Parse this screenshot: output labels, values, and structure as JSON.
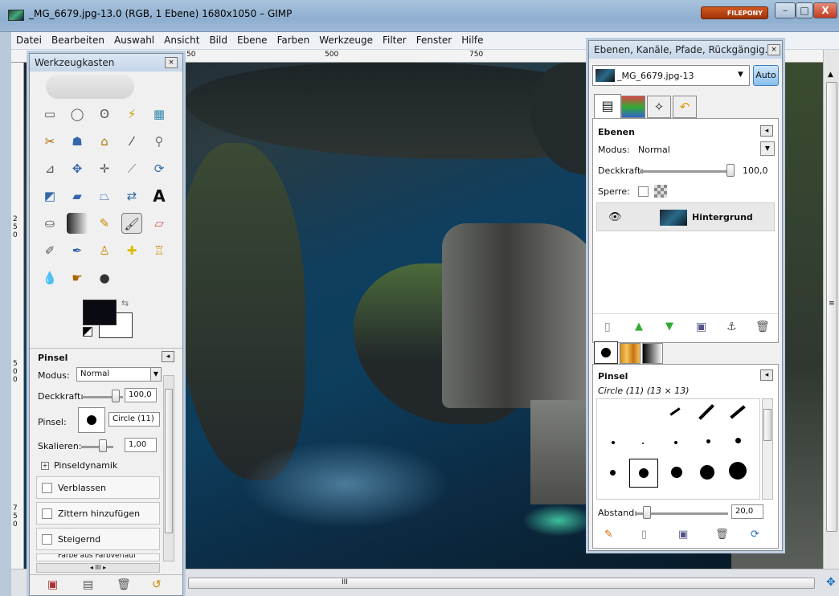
{
  "window": {
    "title": "_MG_6679.jpg-13.0 (RGB, 1 Ebene) 1680x1050 – GIMP",
    "badge": "FILEPONY",
    "minimize": "–",
    "maximize": "□",
    "close": "X"
  },
  "menu": [
    "Datei",
    "Bearbeiten",
    "Auswahl",
    "Ansicht",
    "Bild",
    "Ebene",
    "Farben",
    "Werkzeuge",
    "Filter",
    "Fenster",
    "Hilfe"
  ],
  "ruler": {
    "top": [
      "50",
      "500",
      "750"
    ],
    "left": [
      "250",
      "500",
      "750"
    ]
  },
  "toolbox": {
    "title": "Werkzeugkasten",
    "options_title": "Pinsel",
    "modus_label": "Modus:",
    "modus_value": "Normal",
    "deckkraft_label": "Deckkraft:",
    "deckkraft_value": "100,0",
    "pinsel_label": "Pinsel:",
    "pinsel_value": "Circle (11)",
    "skalieren_label": "Skalieren:",
    "skalieren_value": "1,00",
    "dynamik": "Pinseldynamik",
    "checks": [
      "Verblassen",
      "Zittern hinzufügen",
      "Steigernd",
      "Farbe aus Farbverlauf"
    ]
  },
  "layers": {
    "title": "Ebenen, Kanäle, Pfade, Rückgängig...",
    "image": "_MG_6679.jpg-13",
    "auto": "Auto",
    "section": "Ebenen",
    "modus_label": "Modus:",
    "modus_value": "Normal",
    "deckkraft_label": "Deckkraft:",
    "deckkraft_value": "100,0",
    "sperre_label": "Sperre:",
    "layer_name": "Hintergrund"
  },
  "brushes": {
    "section": "Pinsel",
    "current": "Circle (11) (13 × 13)",
    "abstand_label": "Abstand:",
    "abstand_value": "20,0"
  },
  "scroll": {
    "h_thumb": "III",
    "v_thumb": "≡"
  },
  "colors": {
    "accent": "#1d6fb8",
    "canvas": "#0d3d5c"
  }
}
